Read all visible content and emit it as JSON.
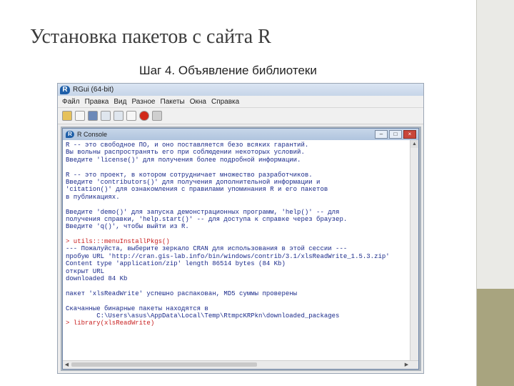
{
  "slide": {
    "title": "Установка пакетов с сайта R",
    "subtitle": "Шаг 4. Объявление библиотеки"
  },
  "rgui": {
    "title": "RGui (64-bit)",
    "menu": [
      "Файл",
      "Правка",
      "Вид",
      "Разное",
      "Пакеты",
      "Окна",
      "Справка"
    ],
    "toolbar_icons": [
      "open-script-icon",
      "load-workspace-icon",
      "save-workspace-icon",
      "copy-icon",
      "paste-icon",
      "copy-paste-icon",
      "stop-icon",
      "print-icon"
    ]
  },
  "console": {
    "title": "R Console",
    "buttons": {
      "minimize": "–",
      "maximize": "□",
      "close": "×"
    },
    "lines": [
      {
        "text": "R -- это свободное ПО, и оно поставляется безо всяких гарантий.",
        "type": "out"
      },
      {
        "text": "Вы вольны распространять его при соблюдении некоторых условий.",
        "type": "out"
      },
      {
        "text": "Введите 'license()' для получения более подробной информации.",
        "type": "out"
      },
      {
        "text": "",
        "type": "gap"
      },
      {
        "text": "R -- это проект, в котором сотрудничает множество разработчиков.",
        "type": "out"
      },
      {
        "text": "Введите 'contributors()' для получения дополнительной информации и",
        "type": "out"
      },
      {
        "text": "'citation()' для ознакомления с правилами упоминания R и его пакетов",
        "type": "out"
      },
      {
        "text": "в публикациях.",
        "type": "out"
      },
      {
        "text": "",
        "type": "gap"
      },
      {
        "text": "Введите 'demo()' для запуска демонстрационных программ, 'help()' -- для",
        "type": "out"
      },
      {
        "text": "получения справки, 'help.start()' -- для доступа к справке через браузер.",
        "type": "out"
      },
      {
        "text": "Введите 'q()', чтобы выйти из R.",
        "type": "out"
      },
      {
        "text": "",
        "type": "gap"
      },
      {
        "text": "> utils:::menuInstallPkgs()",
        "type": "cmd"
      },
      {
        "text": "--- Пожалуйста, выберите зеркало CRAN для использования в этой сессии ---",
        "type": "out"
      },
      {
        "text": "пробую URL 'http://cran.gis-lab.info/bin/windows/contrib/3.1/xlsReadWrite_1.5.3.zip'",
        "type": "out"
      },
      {
        "text": "Content type 'application/zip' length 86514 bytes (84 Kb)",
        "type": "out"
      },
      {
        "text": "открыт URL",
        "type": "out"
      },
      {
        "text": "downloaded 84 Kb",
        "type": "out"
      },
      {
        "text": "",
        "type": "gap"
      },
      {
        "text": "пакет 'xlsReadWrite' успешно распакован, MD5 суммы проверены",
        "type": "out"
      },
      {
        "text": "",
        "type": "gap"
      },
      {
        "text": "Скачанные бинарные пакеты находятся в",
        "type": "out"
      },
      {
        "text": "        C:\\Users\\asus\\AppData\\Local\\Temp\\RtmpcKRPkn\\downloaded_packages",
        "type": "out"
      },
      {
        "text": "> library(xlsReadWrite)",
        "type": "cmd"
      }
    ]
  }
}
